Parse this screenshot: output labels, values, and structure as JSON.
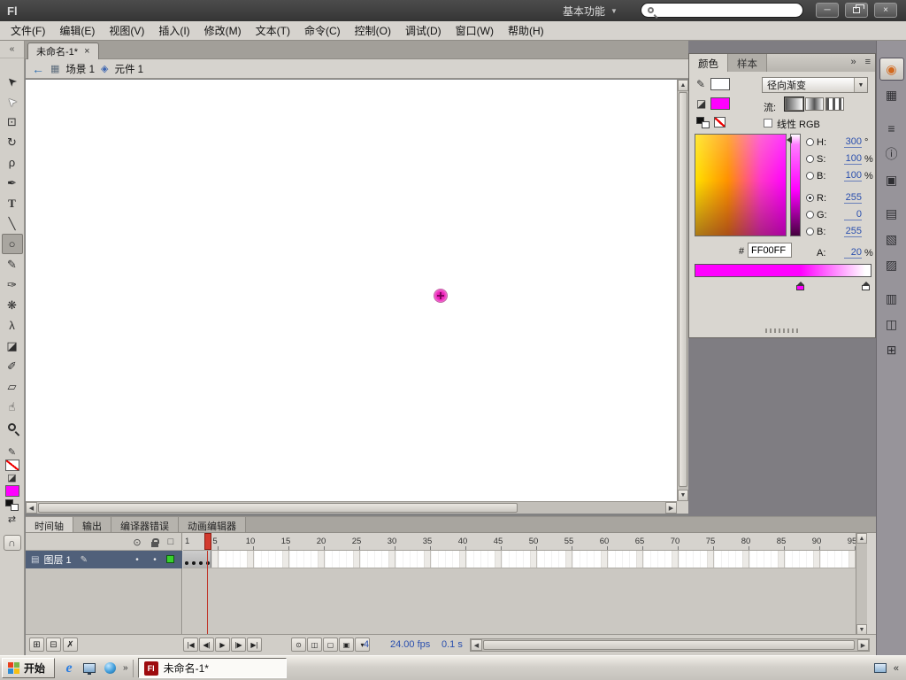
{
  "titlebar": {
    "logo": "Fl",
    "workspace_menu": "基本功能",
    "dropdown_arrow": "▼",
    "search_value": "",
    "buttons": {
      "minimize": "─",
      "close": "×"
    }
  },
  "menubar": {
    "items": [
      "文件(F)",
      "编辑(E)",
      "视图(V)",
      "插入(I)",
      "修改(M)",
      "文本(T)",
      "命令(C)",
      "控制(O)",
      "调试(D)",
      "窗口(W)",
      "帮助(H)"
    ]
  },
  "document_tab": {
    "title": "未命名-1*",
    "close_glyph": "×"
  },
  "editbar": {
    "back_glyph": "←",
    "scene_icon": "▦",
    "scene_label": "场景 1",
    "symbol_icon": "◈",
    "symbol_label": "元件 1"
  },
  "toolbar": {
    "collapse_glyph": "«",
    "tools": [
      {
        "name": "selection-tool",
        "glyph": "➤",
        "cls": "rot-nw"
      },
      {
        "name": "subselection-tool",
        "glyph": "➤",
        "cls": "rot-nw hollow"
      },
      {
        "name": "free-transform-tool",
        "glyph": "⊡"
      },
      {
        "name": "3d-rotation-tool",
        "glyph": "↻"
      },
      {
        "name": "lasso-tool",
        "glyph": "ρ"
      },
      {
        "name": "pen-tool",
        "glyph": "✒"
      },
      {
        "name": "text-tool",
        "glyph": "T",
        "cls": "boldy"
      },
      {
        "name": "line-tool",
        "glyph": "╲"
      },
      {
        "name": "oval-tool",
        "glyph": "○",
        "selected": true
      },
      {
        "name": "pencil-tool",
        "glyph": "✎"
      },
      {
        "name": "brush-tool",
        "glyph": "✑"
      },
      {
        "name": "deco-tool",
        "glyph": "❋"
      },
      {
        "name": "bone-tool",
        "glyph": "λ"
      },
      {
        "name": "paint-bucket-tool",
        "glyph": "◪"
      },
      {
        "name": "eyedropper-tool",
        "glyph": "✐"
      },
      {
        "name": "eraser-tool",
        "glyph": "▱"
      },
      {
        "name": "hand-tool",
        "glyph": "☝"
      },
      {
        "name": "zoom-tool",
        "glyph": "",
        "cls": "zoomer"
      }
    ],
    "stroke_icon": "✎",
    "fill_icon": "◪",
    "swap_glyph": "⇄",
    "snap_glyph": "∩",
    "fill_color": "#FF00FF"
  },
  "color_panel": {
    "tabs": [
      {
        "name": "tab-color",
        "label": "颜色",
        "active": true
      },
      {
        "name": "tab-swatches",
        "label": "样本"
      }
    ],
    "collapse_glyph": "»",
    "menu_glyph": "≡",
    "stroke_icon": "✎",
    "fill_icon": "◪",
    "type_value": "径向渐变",
    "type_arrow": "▼",
    "flow_label": "流:",
    "flow_buttons": [
      {
        "name": "flow-extend-button",
        "cls": "flow1",
        "selected": true
      },
      {
        "name": "flow-reflect-button",
        "cls": "flow2"
      },
      {
        "name": "flow-repeat-button",
        "cls": "flow3"
      }
    ],
    "linear_rgb_label": "线性 RGB",
    "hsb_rows": [
      {
        "name": "hue-row",
        "label": "H:",
        "value": "300",
        "unit": "°"
      },
      {
        "name": "saturation-row",
        "label": "S:",
        "value": "100",
        "unit": "%"
      },
      {
        "name": "brightness-row",
        "label": "B:",
        "value": "100",
        "unit": "%"
      }
    ],
    "rgb_rows": [
      {
        "name": "red-row",
        "label": "R:",
        "value": "255",
        "selected": true
      },
      {
        "name": "green-row",
        "label": "G:",
        "value": "0"
      },
      {
        "name": "blue-row",
        "label": "B:",
        "value": "255"
      }
    ],
    "alpha_label": "A:",
    "alpha_value": "20",
    "alpha_unit": "%",
    "hex_prefix": "#",
    "hex_value": "FF00FF",
    "fill_color": "#FF00FF",
    "gradient_stops": [
      {
        "color": "#FF00FF",
        "pos": 60
      },
      {
        "color": "#FFFFFF",
        "pos": 97
      }
    ]
  },
  "dock": {
    "icons": [
      {
        "name": "color-panel-icon",
        "glyph": "◉",
        "active": true,
        "cls": "warm"
      },
      {
        "name": "swatches-panel-icon",
        "glyph": "▦"
      },
      {
        "name": "align-panel-icon",
        "glyph": "≡",
        "cls": "gap"
      },
      {
        "name": "info-panel-icon",
        "glyph": "ⓘ"
      },
      {
        "name": "transform-panel-icon",
        "glyph": "▣"
      },
      {
        "name": "code-snippets-panel-icon",
        "glyph": "▤",
        "cls": "gap"
      },
      {
        "name": "components-panel-icon",
        "glyph": "▧"
      },
      {
        "name": "motion-presets-panel-icon",
        "glyph": "▨"
      },
      {
        "name": "library-panel-icon",
        "glyph": "▥",
        "cls": "gap"
      },
      {
        "name": "behaviors-panel-icon",
        "glyph": "◫"
      },
      {
        "name": "history-panel-icon",
        "glyph": "⊞"
      }
    ]
  },
  "timeline": {
    "tabs": [
      {
        "name": "tab-timeline",
        "label": "时间轴",
        "active": true
      },
      {
        "name": "tab-output",
        "label": "输出"
      },
      {
        "name": "tab-compiler-errors",
        "label": "编译器错误"
      },
      {
        "name": "tab-motion-editor",
        "label": "动画编辑器"
      }
    ],
    "layer_icon": "▤",
    "layer_pencil": "✎",
    "layer_name": "图层 1",
    "show_dot": "•",
    "lock_dot": "•",
    "ruler_first": "1",
    "ruler_numbers": [
      "5",
      "10",
      "15",
      "20",
      "25",
      "30",
      "35",
      "40",
      "45",
      "50",
      "55",
      "60",
      "65",
      "70",
      "75",
      "80",
      "85",
      "90",
      "95"
    ],
    "playhead_frame": 4,
    "keyframes": [
      {
        "frame": 1
      },
      {
        "frame": 2
      },
      {
        "frame": 3
      },
      {
        "frame": 4
      }
    ],
    "buttons": {
      "new_layer": "⊞",
      "new_folder": "⊟",
      "delete_layer": "✗"
    },
    "playback": [
      {
        "name": "goto-first-frame-button",
        "glyph": "|◀"
      },
      {
        "name": "step-back-button",
        "glyph": "◀|"
      },
      {
        "name": "play-button",
        "glyph": "▶"
      },
      {
        "name": "step-forward-button",
        "glyph": "|▶"
      },
      {
        "name": "goto-last-frame-button",
        "glyph": "▶|"
      }
    ],
    "onion": [
      {
        "name": "center-frame-button",
        "glyph": "⊙"
      },
      {
        "name": "onion-skin-button",
        "glyph": "◫"
      },
      {
        "name": "onion-skin-outlines-button",
        "glyph": "▢"
      },
      {
        "name": "edit-multiple-frames-button",
        "glyph": "▣"
      },
      {
        "name": "modify-markers-button",
        "glyph": "▾"
      }
    ],
    "status": {
      "current_frame": "4",
      "frame_rate": "24.00 fps",
      "elapsed_time": "0.1 s"
    }
  },
  "taskbar": {
    "start_label": "开始",
    "quicklaunch_expand": "»",
    "task_icon": "Fl",
    "task_label": "未命名-1*",
    "tray_collapse": "«"
  },
  "canvas": {
    "stage_object_color": "#EE22BB"
  }
}
